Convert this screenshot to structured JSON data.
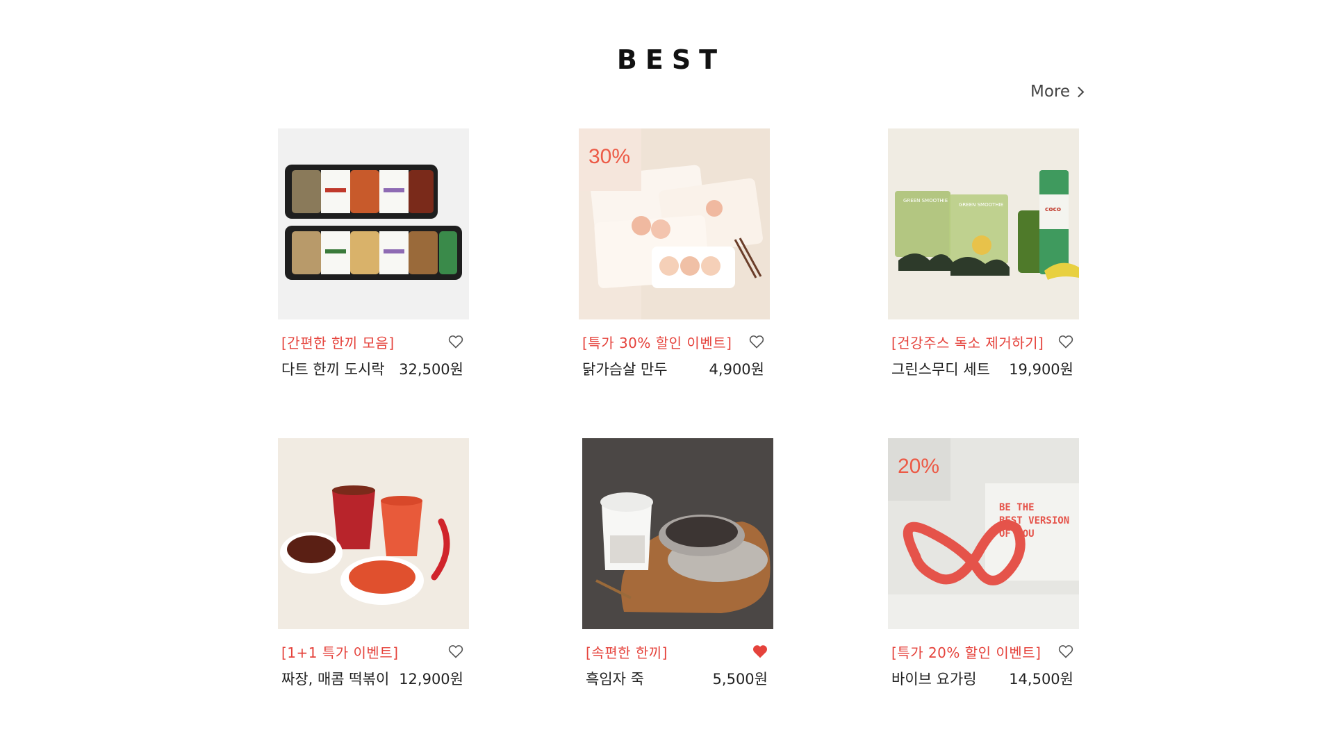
{
  "section": {
    "title": "BEST",
    "more_label": "More"
  },
  "products": [
    {
      "event": "[간편한 한끼 모음]",
      "name": "다트 한끼 도시락",
      "price": "32,500원",
      "liked": false,
      "image": "lunchbox-set-image"
    },
    {
      "event": "[특가 30% 할인 이벤트]",
      "name": "닭가슴살 만두",
      "price": "4,900원",
      "liked": false,
      "badge": "30%",
      "image": "chicken-dumpling-image"
    },
    {
      "event": "[건강주스 독소 제거하기]",
      "name": "그린스무디 세트",
      "price": "19,900원",
      "liked": false,
      "image": "green-smoothie-image",
      "image_text": [
        "GREEN SMOOTHIE",
        "GREEN SMOOTHIE",
        "coco"
      ]
    },
    {
      "event": "[1+1 특가 이벤트]",
      "name": "짜장, 매콤 떡볶이",
      "price": "12,900원",
      "liked": false,
      "image": "tteokbokki-cup-image"
    },
    {
      "event": "[속편한 한끼]",
      "name": "흑임자 죽",
      "price": "5,500원",
      "liked": true,
      "image": "black-sesame-porridge-image"
    },
    {
      "event": "[특가 20% 할인 이벤트]",
      "name": "바이브 요가링",
      "price": "14,500원",
      "liked": false,
      "badge": "20%",
      "image": "yoga-ring-image",
      "image_text": [
        "BE THE",
        "BEST VERSION",
        "OF YOU"
      ]
    }
  ],
  "colors": {
    "accent": "#e5423b",
    "text": "#222222",
    "heart_filled": "#e5423b"
  }
}
